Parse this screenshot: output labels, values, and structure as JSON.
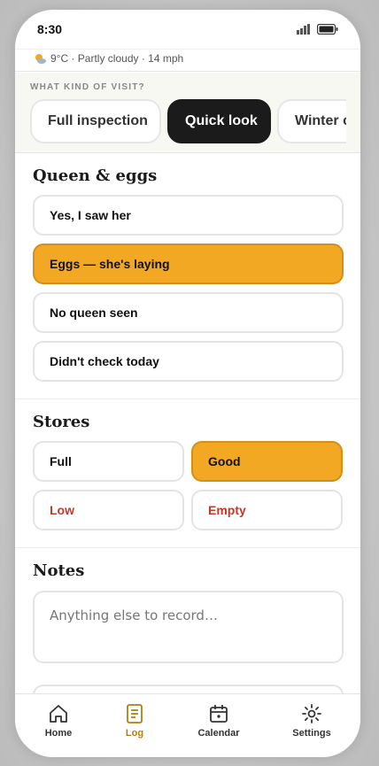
{
  "status": {
    "time": "8:30"
  },
  "weather": {
    "text": "9°C · Partly cloudy · 14 mph"
  },
  "visit": {
    "label": "WHAT KIND OF VISIT?",
    "chips": [
      "Full inspection",
      "Quick look",
      "Winter check"
    ],
    "selected": "Quick look"
  },
  "queen": {
    "title": "Queen & eggs",
    "options": [
      "Yes, I saw her",
      "Eggs — she's laying",
      "No queen seen",
      "Didn't check today"
    ],
    "selected": "Eggs — she's laying"
  },
  "stores": {
    "title": "Stores",
    "options": [
      "Full",
      "Good",
      "Low",
      "Empty"
    ],
    "selected": "Good"
  },
  "notes": {
    "title": "Notes",
    "placeholder": "Anything else to record…"
  },
  "tabs": [
    {
      "label": "Home",
      "icon": "home-icon"
    },
    {
      "label": "Log",
      "icon": "log-icon"
    },
    {
      "label": "Calendar",
      "icon": "calendar-icon"
    },
    {
      "label": "Settings",
      "icon": "settings-icon"
    }
  ],
  "active_tab": "Log",
  "colors": {
    "accent": "#f2a823",
    "accent_dark": "#b17f10",
    "selected_chip": "#1b1b1b",
    "warning_text": "#c0392b"
  }
}
